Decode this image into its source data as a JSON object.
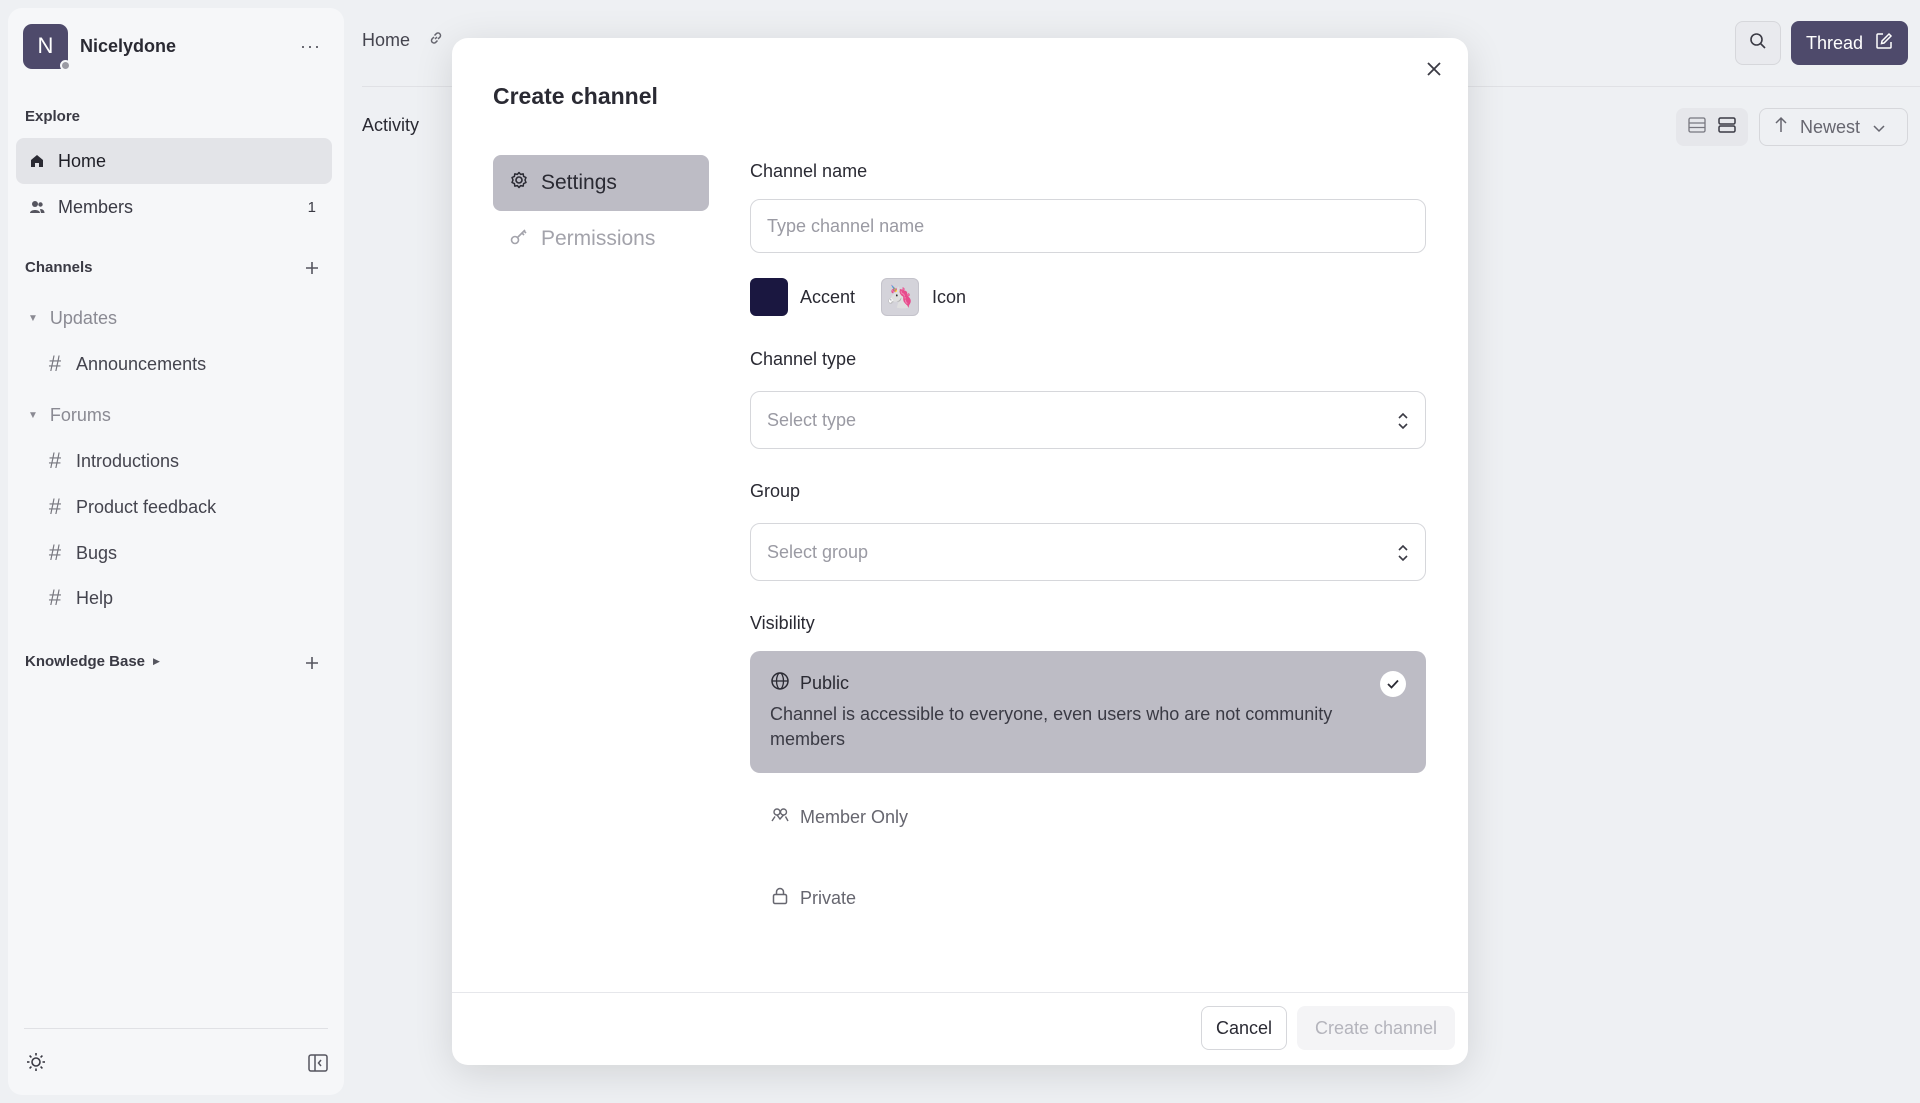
{
  "workspace": {
    "initial": "N",
    "name": "Nicelydone",
    "more": "···"
  },
  "sidebar": {
    "explore_label": "Explore",
    "items": [
      {
        "label": "Home",
        "icon": "home-icon"
      },
      {
        "label": "Members",
        "icon": "members-icon",
        "count": "1"
      }
    ],
    "channels_label": "Channels",
    "groups": [
      {
        "label": "Updates",
        "channels": [
          "Announcements"
        ]
      },
      {
        "label": "Forums",
        "channels": [
          "Introductions",
          "Product feedback",
          "Bugs",
          "Help"
        ]
      }
    ],
    "knowledge_base_label": "Knowledge Base"
  },
  "header": {
    "breadcrumb": "Home",
    "thread_label": "Thread"
  },
  "main": {
    "activity_label": "Activity",
    "sort_label": "Newest"
  },
  "modal": {
    "title": "Create channel",
    "tabs": [
      {
        "label": "Settings",
        "icon": "gear-icon"
      },
      {
        "label": "Permissions",
        "icon": "key-icon"
      }
    ],
    "channel_name": {
      "label": "Channel name",
      "placeholder": "Type channel name",
      "value": ""
    },
    "accent_label": "Accent",
    "accent_color": "#1a1740",
    "icon_label": "Icon",
    "icon_emoji": "🦄",
    "channel_type": {
      "label": "Channel type",
      "placeholder": "Select type"
    },
    "group": {
      "label": "Group",
      "placeholder": "Select group"
    },
    "visibility": {
      "label": "Visibility",
      "selected": {
        "title": "Public",
        "description": "Channel is accessible to everyone, even users who are not community members"
      },
      "options": [
        "Member Only",
        "Private"
      ]
    },
    "cancel_label": "Cancel",
    "create_label": "Create channel"
  }
}
